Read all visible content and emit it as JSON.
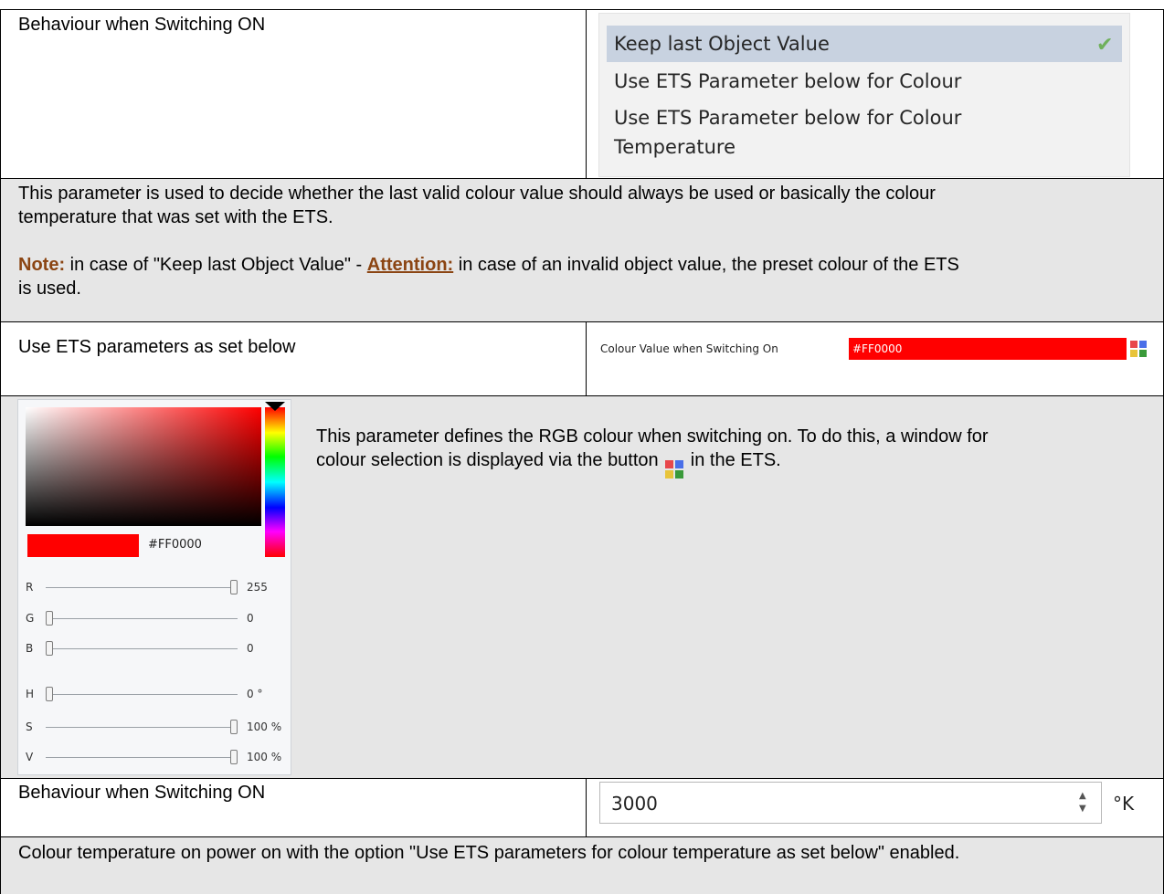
{
  "row1": {
    "label": "Behaviour when Switching ON",
    "options": [
      "Keep last Object Value",
      "Use ETS Parameter below for Colour",
      "Use ETS Parameter below for Colour",
      "Temperature"
    ],
    "selected_index": 0
  },
  "desc1": {
    "line1": "This parameter is used to decide whether the last valid colour value should always be used or basically the colour",
    "line2": "temperature that was set with the ETS.",
    "note_label": "Note:",
    "note_text_a": " in case of \"Keep last Object Value\" - ",
    "attention_label": "Attention:",
    "note_text_b": " in case of an invalid object value, the preset colour of the ETS",
    "note_line2": "is used."
  },
  "row2": {
    "label": "Use ETS parameters as set below",
    "field_label": "Colour Value when Switching On",
    "field_value": "#FF0000"
  },
  "picker": {
    "hex": "#FF0000",
    "sliders": [
      {
        "channel": "R",
        "value": "255",
        "level": 1.0
      },
      {
        "channel": "G",
        "value": "0",
        "level": 0.0
      },
      {
        "channel": "B",
        "value": "0",
        "level": 0.0
      },
      {
        "channel": "H",
        "value": "0 °",
        "level": 0.0
      },
      {
        "channel": "S",
        "value": "100 %",
        "level": 1.0
      },
      {
        "channel": "V",
        "value": "100 %",
        "level": 1.0
      }
    ]
  },
  "desc2": {
    "line1": "This parameter defines the RGB colour when switching on. To do this, a window for",
    "line2a": "colour selection is displayed via the button ",
    "line2b": " in the ETS."
  },
  "row3": {
    "label": "Behaviour when Switching ON",
    "spin_value": "3000",
    "unit": "°K"
  },
  "desc3": {
    "line1": "Colour temperature on power on with the option \"Use ETS parameters for colour temperature as set below\" enabled."
  },
  "colors": {
    "grey_cell": "#e6e6e6",
    "selected_option": "#c8d2e0",
    "check": "#6fb05b",
    "note": "#8b4513",
    "palette": [
      "#e8474c",
      "#4a6fe8",
      "#e8c43a",
      "#3a9a3a"
    ]
  }
}
